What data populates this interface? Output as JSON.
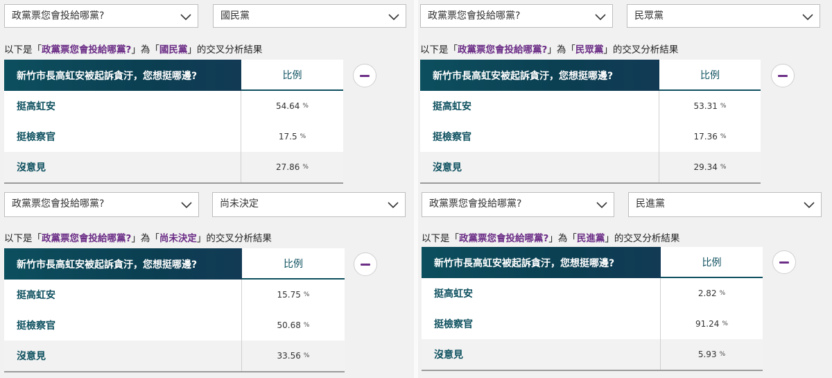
{
  "common": {
    "question_dropdown": "政黨票您會投給哪黨?",
    "caption_prefix": "以下是「",
    "caption_question": "政黨票您會投給哪黨?",
    "caption_mid": "」為「",
    "caption_suffix": "」的交叉分析結果",
    "table_header_question": "新竹市長高虹安被起訴貪汙，您想挺哪邊?",
    "table_header_ratio": "比例",
    "pct_unit": "%",
    "row_labels": [
      "挺高虹安",
      "挺檢察官",
      "沒意見"
    ]
  },
  "panels": [
    {
      "party": "國民黨",
      "values": [
        "54.64",
        "17.5",
        "27.86"
      ]
    },
    {
      "party": "民眾黨",
      "values": [
        "53.31",
        "17.36",
        "29.34"
      ]
    },
    {
      "party": "尚未決定",
      "values": [
        "15.75",
        "50.68",
        "33.56"
      ]
    },
    {
      "party": "民進黨",
      "values": [
        "2.82",
        "91.24",
        "5.93"
      ]
    }
  ],
  "icons": {
    "dropdown": "chevron-down-icon",
    "collapse": "minus-circle-icon"
  },
  "colors": {
    "header_bg": "#0c4f5e",
    "accent": "#6b2d86"
  }
}
